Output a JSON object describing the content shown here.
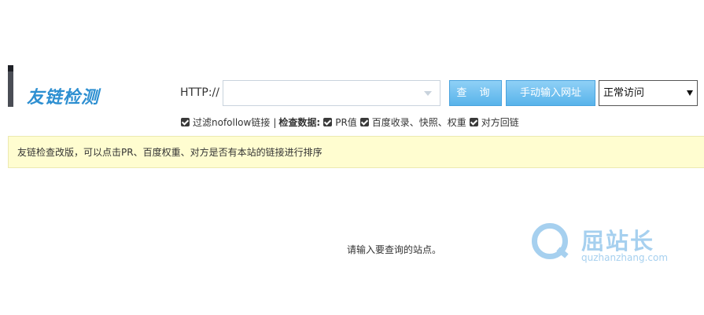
{
  "header": {
    "title": "友链检测",
    "http_label": "HTTP://",
    "url_input": {
      "value": "",
      "placeholder": ""
    },
    "query_button": "查 询",
    "manual_button": "手动输入网址",
    "mode_select": {
      "selected": "正常访问"
    }
  },
  "options": {
    "filter_nofollow": {
      "label": "过滤nofollow链接",
      "checked": true
    },
    "separator": "|",
    "check_data_label": "检查数据:",
    "checks": [
      {
        "label": "PR值",
        "checked": true
      },
      {
        "label": "百度收录、快照、权重",
        "checked": true
      },
      {
        "label": "对方回链",
        "checked": true
      }
    ]
  },
  "notice": "友链检查改版，可以点击PR、百度权重、对方是否有本站的链接进行排序",
  "empty_message": "请输入要查询的站点。",
  "watermark": {
    "name": "屈站长",
    "url": "quzhanzhang.com"
  },
  "colors": {
    "accent": "#2d8fd1",
    "button": "#58b3ea",
    "notice_bg": "#fffdd0",
    "watermark": "#a6d0ef"
  }
}
